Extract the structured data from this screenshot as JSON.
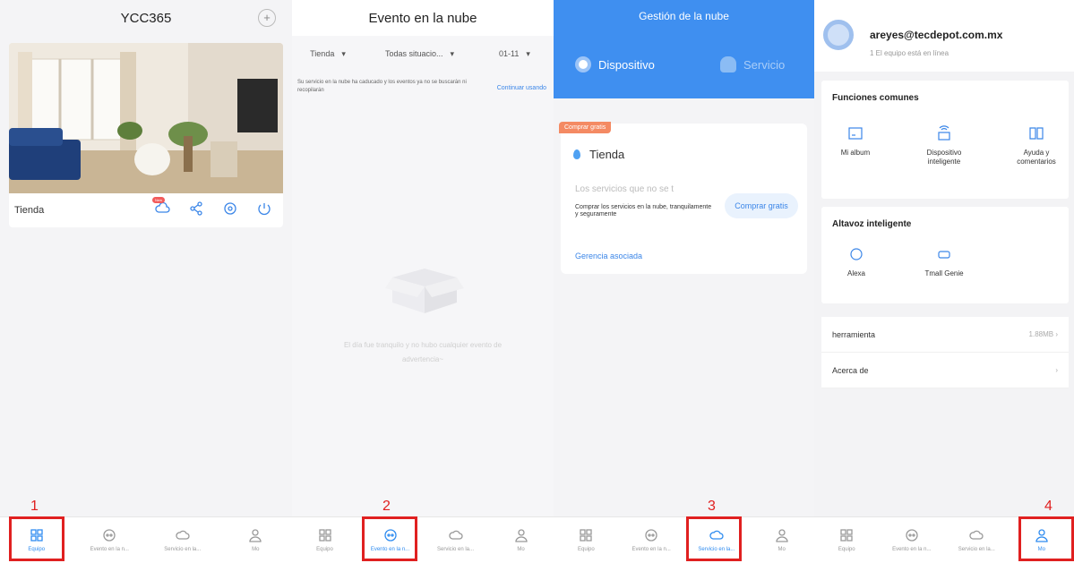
{
  "screen1": {
    "title": "YCC365",
    "camera_name": "Tienda",
    "new_badge": "New",
    "step_number": "1",
    "nav": [
      "Equipo",
      "Evento en la n...",
      "Servicio en la...",
      "Mo"
    ]
  },
  "screen2": {
    "title": "Evento en la nube",
    "filters": [
      "Tienda",
      "Todas situacio...",
      "01-11"
    ],
    "notice": "Su servicio en la nube ha caducado y los eventos ya no se buscarán ni recopilarán",
    "continue": "Continuar usando",
    "empty_line1": "El día fue tranquilo y no hubo cualquier evento de",
    "empty_line2": "advertencia~",
    "step_number": "2",
    "nav": [
      "Equipo",
      "Evento en la n...",
      "Servicio en la...",
      "Mo"
    ]
  },
  "screen3": {
    "title": "Gestión de la nube",
    "tab_device": "Dispositivo",
    "tab_service": "Servicio",
    "free_badge": "Comprar gratis",
    "device": "Tienda",
    "services_title": "Los servicios que no se t",
    "services_desc": "Comprar los servicios en la nube, tranquilamente y seguramente",
    "buy_button": "Comprar gratis",
    "associated": "Gerencia asociada",
    "step_number": "3",
    "nav": [
      "Equipo",
      "Evento en la n...",
      "Servicio en la...",
      "Mo"
    ]
  },
  "screen4": {
    "email": "areyes@tecdepot.com.mx",
    "online": "1 El equipo está en línea",
    "common_title": "Funciones comunes",
    "common": [
      "Mi album",
      "Dispositivo inteligente",
      "Ayuda y comentarios"
    ],
    "speaker_title": "Altavoz inteligente",
    "speakers": [
      "Alexa",
      "Tmall Genie"
    ],
    "tool_label": "herramienta",
    "tool_size": "1.88MB",
    "about": "Acerca de",
    "step_number": "4",
    "nav": [
      "Equipo",
      "Evento en la n...",
      "Servicio en la...",
      "Mo"
    ]
  },
  "colors": {
    "accent": "#3f8ff0",
    "highlight": "#e02020",
    "badge": "#f48a63"
  }
}
